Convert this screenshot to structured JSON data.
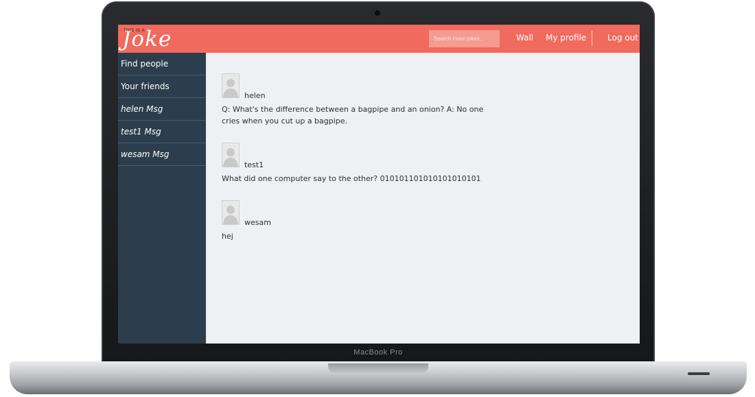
{
  "device": {
    "model_label": "MacBook Pro"
  },
  "header": {
    "logo_small": "THIS IS A",
    "logo_big": "Joke",
    "search_placeholder": "Search more jokes...",
    "nav": [
      {
        "label": "Wall"
      },
      {
        "label": "My profile"
      },
      {
        "label": "Log out"
      }
    ]
  },
  "sidebar": {
    "items": [
      {
        "label": "Find people"
      },
      {
        "label": "Your friends"
      },
      {
        "label": "helen Msg"
      },
      {
        "label": "test1 Msg"
      },
      {
        "label": "wesam Msg"
      }
    ]
  },
  "feed": {
    "posts": [
      {
        "user": "helen",
        "text": "Q: What's the difference between a bagpipe and an onion? A: No one cries when you cut up a bagpipe."
      },
      {
        "user": "test1",
        "text": "What did one computer say to the other? 010101101010101010101"
      },
      {
        "user": "wesam",
        "text": "hej"
      }
    ]
  },
  "colors": {
    "header": "#f06a5e",
    "sidebar": "#2c3e4d",
    "content_bg": "#eef0f4"
  }
}
